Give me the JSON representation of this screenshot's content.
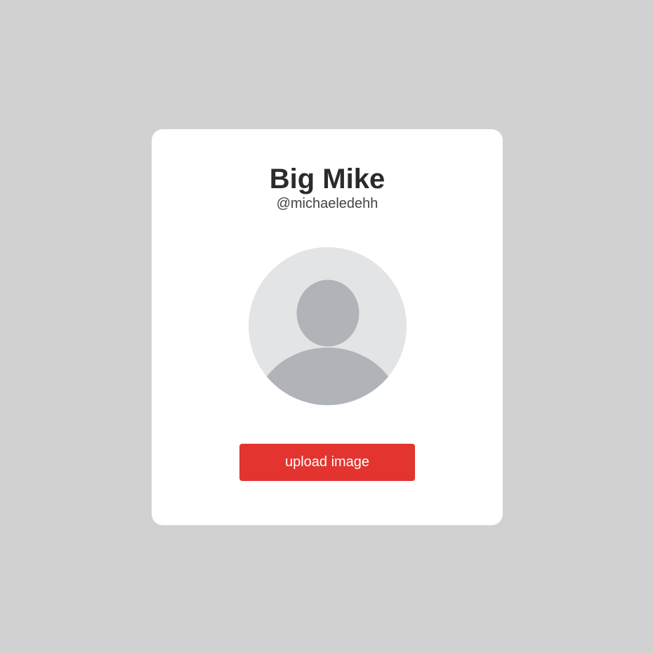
{
  "profile": {
    "name": "Big Mike",
    "handle": "@michaeledehh",
    "avatar_icon": "user-placeholder-icon",
    "upload_label": "upload image"
  },
  "colors": {
    "background": "#d1d1d1",
    "card": "#ffffff",
    "button": "#e3342f",
    "avatar_bg": "#e3e4e6",
    "avatar_figure": "#b0b4b8"
  }
}
